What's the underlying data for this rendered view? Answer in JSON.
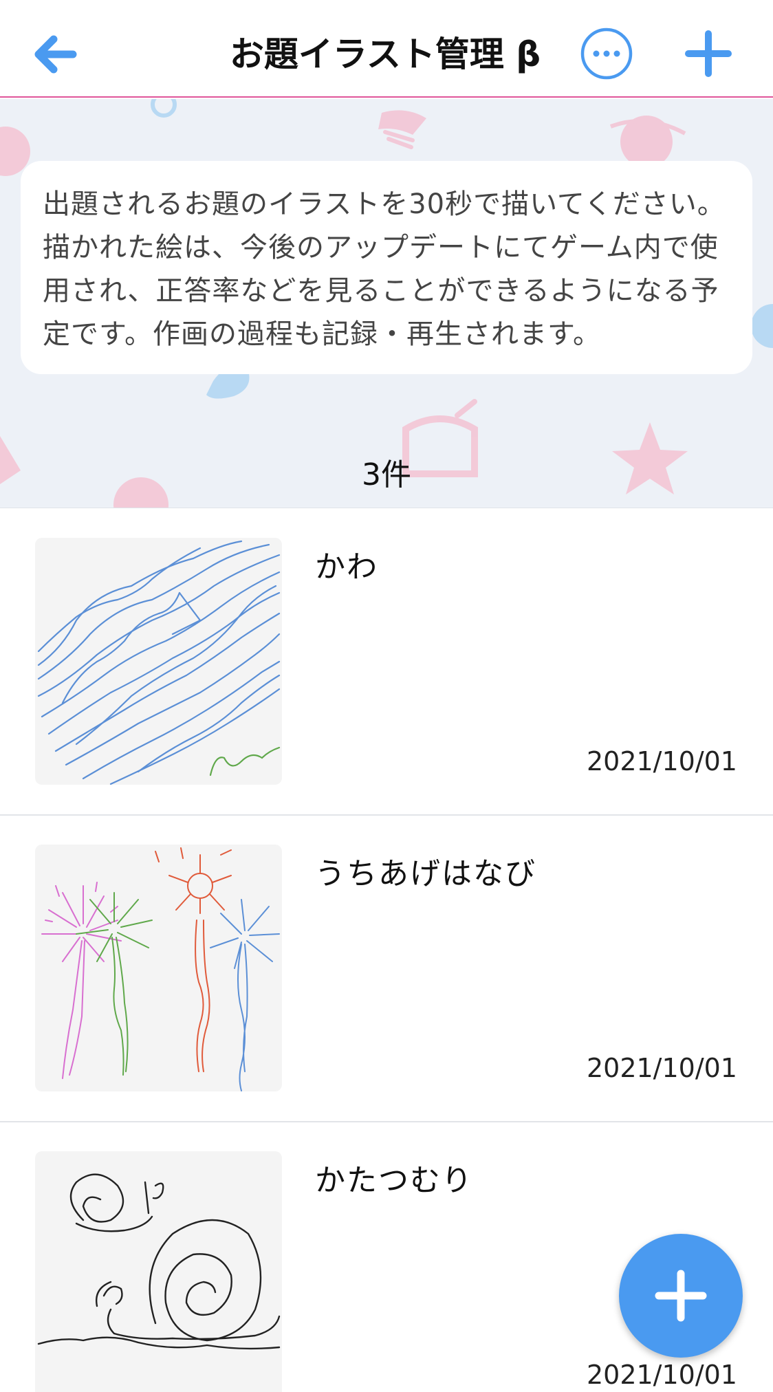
{
  "header": {
    "title": "お題イラスト管理 β",
    "back_icon": "arrow-left-icon",
    "more_icon": "ellipsis-circle-icon",
    "add_icon": "plus-icon",
    "accent_color": "#4a9af0"
  },
  "banner": {
    "description": "出題されるお題のイラストを30秒で描いてください。描かれた絵は、今後のアップデートにてゲーム内で使用され、正答率などを見ることができるようになる予定です。作画の過程も記録・再生されます。",
    "count": "3件"
  },
  "items": [
    {
      "title": "かわ",
      "date": "2021/10/01",
      "thumbnail": "river-drawing"
    },
    {
      "title": "うちあげはなび",
      "date": "2021/10/01",
      "thumbnail": "fireworks-drawing"
    },
    {
      "title": "かたつむり",
      "date": "2021/10/01",
      "thumbnail": "snail-drawing"
    }
  ],
  "fab": {
    "icon": "plus-icon",
    "color": "#4a9af0"
  }
}
